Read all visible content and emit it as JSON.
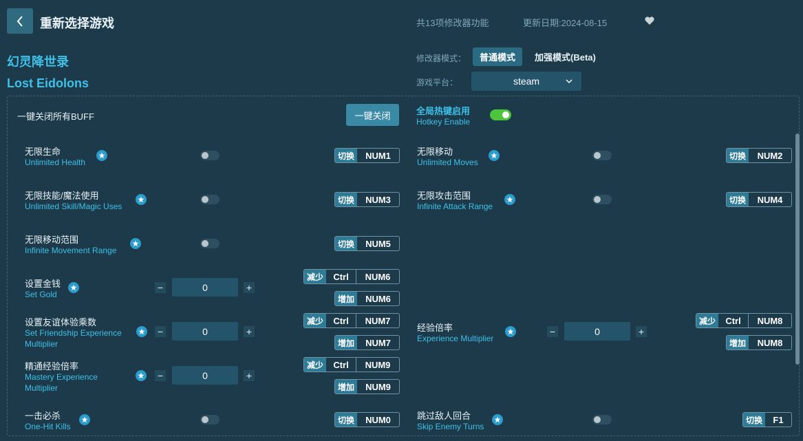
{
  "header": {
    "title": "重新选择游戏",
    "feature_count": "共13项修改器功能",
    "update_date": "更新日期:2024-08-15"
  },
  "game": {
    "name_cn": "幻灵降世录",
    "name_en": "Lost Eidolons"
  },
  "mode": {
    "label": "修改器模式：",
    "normal": "普通模式",
    "enhanced": "加强模式(Beta)"
  },
  "platform": {
    "label": "游戏平台：",
    "value": "steam"
  },
  "global": {
    "close_all_label": "一键关闭所有BUFF",
    "close_all_button": "一键关闭",
    "hotkey_cn": "全局热键启用",
    "hotkey_en": "Hotkey Enable"
  },
  "labels": {
    "toggle": "切换",
    "decrease": "减少",
    "increase": "增加",
    "ctrl": "Ctrl"
  },
  "cheats": {
    "health": {
      "cn": "无限生命",
      "en": "Unlimited Health",
      "key": "NUM1"
    },
    "moves": {
      "cn": "无限移动",
      "en": "Unlimited Moves",
      "key": "NUM2"
    },
    "skill": {
      "cn": "无限技能/魔法使用",
      "en": "Unlimited Skill/Magic Uses",
      "key": "NUM3"
    },
    "attack_range": {
      "cn": "无限攻击范围",
      "en": "Infinite Attack Range",
      "key": "NUM4"
    },
    "move_range": {
      "cn": "无限移动范围",
      "en": "Infinite Movement Range",
      "key": "NUM5"
    },
    "gold": {
      "cn": "设置金钱",
      "en": "Set Gold",
      "value": "0",
      "dec_key": "NUM6",
      "inc_key": "NUM6"
    },
    "friendship": {
      "cn": "设置友谊体验乘数",
      "en1": "Set Friendship Experience",
      "en2": "Multiplier",
      "value": "0",
      "dec_key": "NUM7",
      "inc_key": "NUM7"
    },
    "exp": {
      "cn": "经验倍率",
      "en": "Experience Multiplier",
      "value": "0",
      "dec_key": "NUM8",
      "inc_key": "NUM8"
    },
    "mastery": {
      "cn": "精通经验倍率",
      "en1": "Mastery Experience",
      "en2": "Multiplier",
      "value": "0",
      "dec_key": "NUM9",
      "inc_key": "NUM9"
    },
    "onehit": {
      "cn": "一击必杀",
      "en": "One-Hit Kills",
      "key": "NUM0"
    },
    "skip_turns": {
      "cn": "跳过敌人回合",
      "en": "Skip Enemy Turns",
      "key": "F1"
    }
  }
}
